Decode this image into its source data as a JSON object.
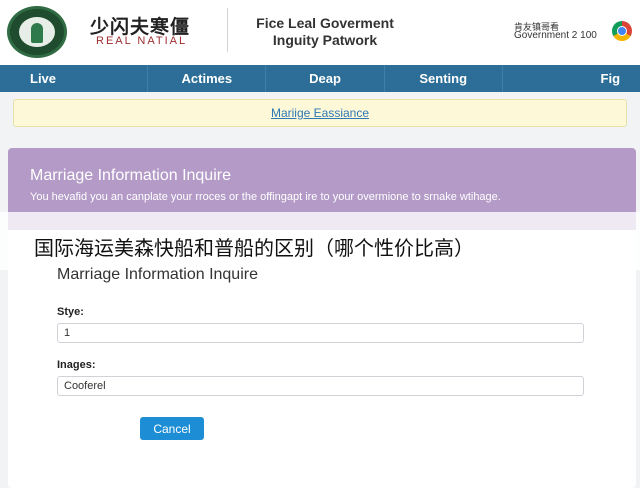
{
  "header": {
    "logo_icon": "government-seal-icon",
    "brand_chinese": "少闪夫寒僵",
    "brand_english": "REAL NATIAL",
    "site_title_line1": "Fice Leal Goverment",
    "site_title_line2": "Inguity Patwork",
    "gov_label": "肯友镇哥看",
    "gov_number": "Government 2 100",
    "browser_icon": "chrome-icon"
  },
  "nav": {
    "items": [
      {
        "label": "Live"
      },
      {
        "label": "Actimes"
      },
      {
        "label": "Deap"
      },
      {
        "label": "Senting"
      },
      {
        "label": "Fig"
      }
    ]
  },
  "alert": {
    "link_text": "Mariige Eassiance"
  },
  "panel": {
    "heading": "Marriage Information Inquire",
    "description": "You hevafid you an canplate your rroces or the offingapt ire to your overmione to srnake wtihage."
  },
  "overlay": {
    "title": "国际海运美森快船和普船的区别（哪个性价比高）"
  },
  "form": {
    "title": "Marriage Information Inquire",
    "style_label": "Stye:",
    "style_value": "1",
    "images_label": "Inages:",
    "images_value": "Cooferel",
    "cancel_label": "Cancel"
  },
  "colors": {
    "nav_bg": "#2c6e98",
    "panel_head_bg": "#b39ac7",
    "alert_bg": "#fcf8d8",
    "button_bg": "#1d8ed6"
  }
}
